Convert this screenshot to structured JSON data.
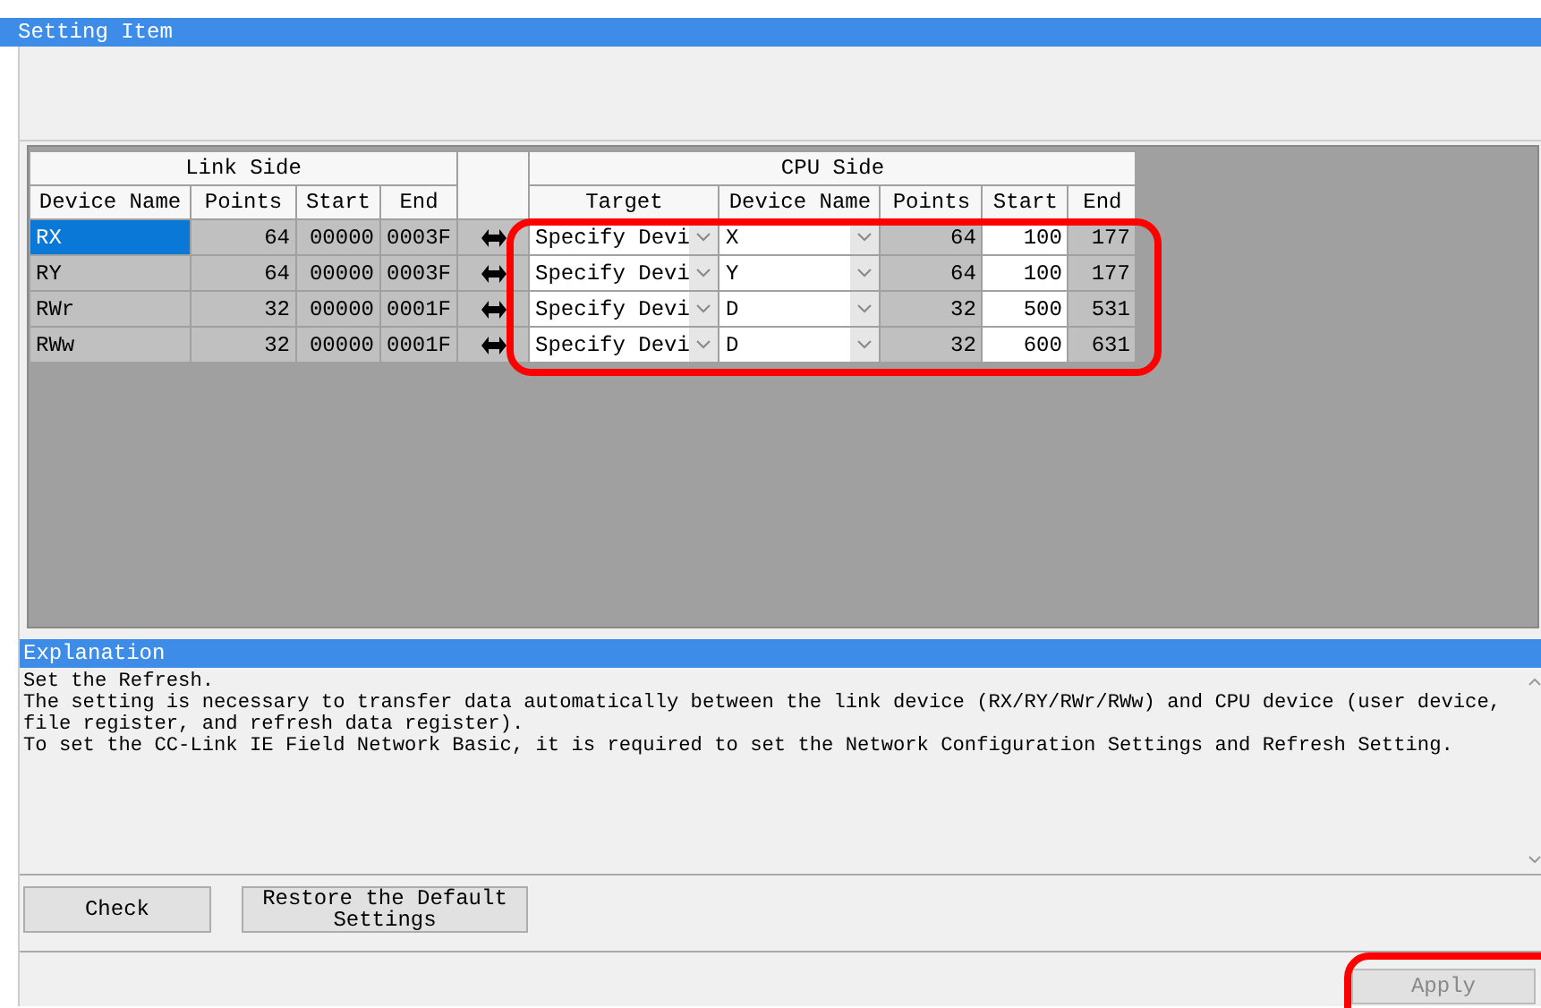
{
  "setting_panel": {
    "title": "Setting Item"
  },
  "table": {
    "groups": [
      "Link Side",
      "CPU Side"
    ],
    "columns": [
      "Device Name",
      "Points",
      "Start",
      "End",
      "Target",
      "Device Name",
      "Points",
      "Start",
      "End"
    ],
    "rows": [
      {
        "selected": true,
        "device": "RX",
        "points": "64",
        "start": "00000",
        "end": "0003F",
        "target": "Specify Devi",
        "cpu_device": "X",
        "cpu_points": "64",
        "cpu_start": "100",
        "cpu_end": "177"
      },
      {
        "selected": false,
        "device": "RY",
        "points": "64",
        "start": "00000",
        "end": "0003F",
        "target": "Specify Devi",
        "cpu_device": "Y",
        "cpu_points": "64",
        "cpu_start": "100",
        "cpu_end": "177"
      },
      {
        "selected": false,
        "device": "RWr",
        "points": "32",
        "start": "00000",
        "end": "0001F",
        "target": "Specify Devi",
        "cpu_device": "D",
        "cpu_points": "32",
        "cpu_start": "500",
        "cpu_end": "531"
      },
      {
        "selected": false,
        "device": "RWw",
        "points": "32",
        "start": "00000",
        "end": "0001F",
        "target": "Specify Devi",
        "cpu_device": "D",
        "cpu_points": "32",
        "cpu_start": "600",
        "cpu_end": "631"
      }
    ]
  },
  "explanation": {
    "title": "Explanation",
    "lines": [
      "Set the Refresh.",
      "The setting is necessary to transfer data automatically between the link device (RX/RY/RWr/RWw) and CPU device (user device, file register, and refresh data register).",
      "To set the CC-Link IE Field Network Basic, it is required to set the Network Configuration Settings and Refresh Setting."
    ]
  },
  "buttons": [
    {
      "label": "Check"
    },
    {
      "label": "Restore the Default Settings"
    }
  ],
  "apply_button": {
    "label": "Apply",
    "disabled": true
  }
}
